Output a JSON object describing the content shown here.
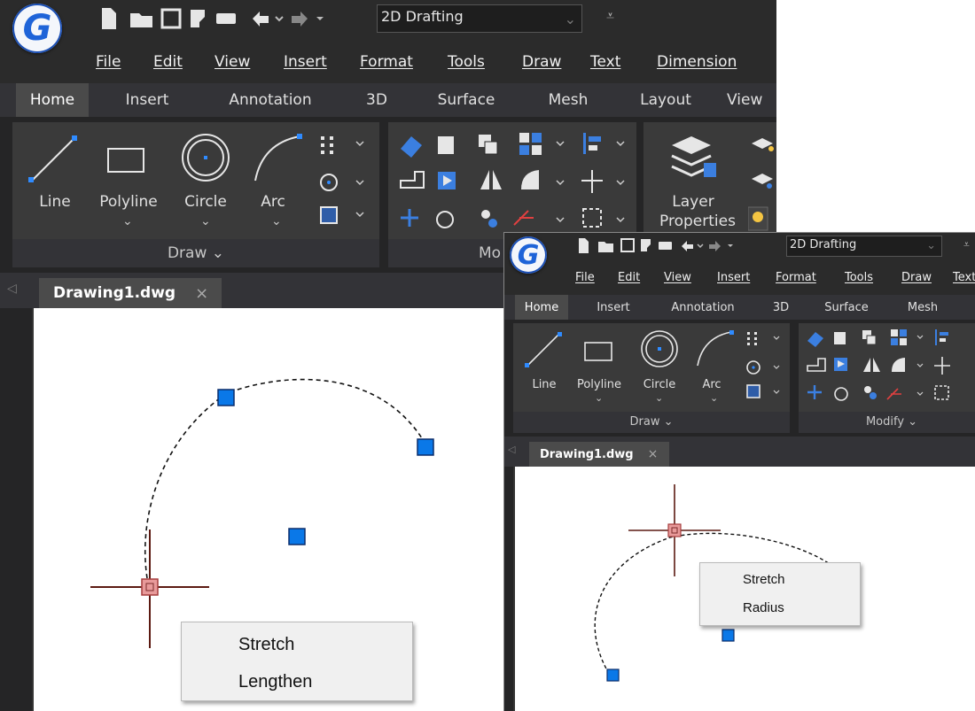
{
  "app": {
    "logo_letter": "G"
  },
  "workspace": {
    "value": "2D Drafting"
  },
  "menu": [
    "File",
    "Edit",
    "View",
    "Insert",
    "Format",
    "Tools",
    "Draw",
    "Text",
    "Dimension"
  ],
  "ribbon_tabs": [
    "Home",
    "Insert",
    "Annotation",
    "3D",
    "Surface",
    "Mesh",
    "Layout",
    "View"
  ],
  "tools": {
    "line": "Line",
    "polyline": "Polyline",
    "circle": "Circle",
    "arc": "Arc",
    "layer_1": "Layer",
    "layer_2": "Properties"
  },
  "panels": {
    "draw": "Draw ⌄",
    "modify": "Modify ⌄",
    "modify_partial": "Mo"
  },
  "doc_tab": {
    "name": "Drawing1.dwg",
    "close": "×"
  },
  "context_menu_1": [
    "Stretch",
    "Lengthen"
  ],
  "context_menu_2": [
    "Stretch",
    "Radius"
  ],
  "colors": {
    "grip": "#0a78e8",
    "grip_hot": "#e89a9a",
    "ribbon": "#3a3a3a",
    "ui_dark": "#252526"
  }
}
